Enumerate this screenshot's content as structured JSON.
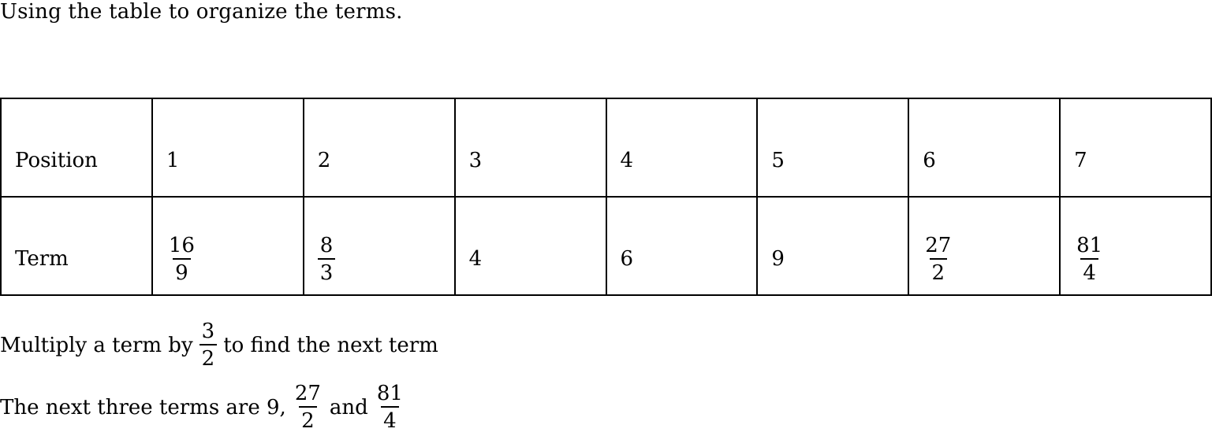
{
  "intro": "Using the table to organize the terms.",
  "table": {
    "row_labels": {
      "position": "Position",
      "term": "Term"
    },
    "positions": [
      "1",
      "2",
      "3",
      "4",
      "5",
      "6",
      "7"
    ],
    "terms": [
      {
        "num": "16",
        "den": "9"
      },
      {
        "num": "8",
        "den": "3"
      },
      {
        "value": "4"
      },
      {
        "value": "6"
      },
      {
        "value": "9"
      },
      {
        "num": "27",
        "den": "2"
      },
      {
        "num": "81",
        "den": "4"
      }
    ]
  },
  "explanation": {
    "line1": {
      "before": "Multiply a term by",
      "frac": {
        "num": "3",
        "den": "2"
      },
      "after": "to find the next term"
    },
    "line2": {
      "before": "The next three terms are 9,",
      "frac1": {
        "num": "27",
        "den": "2"
      },
      "middle": "and",
      "frac2": {
        "num": "81",
        "den": "4"
      }
    }
  }
}
